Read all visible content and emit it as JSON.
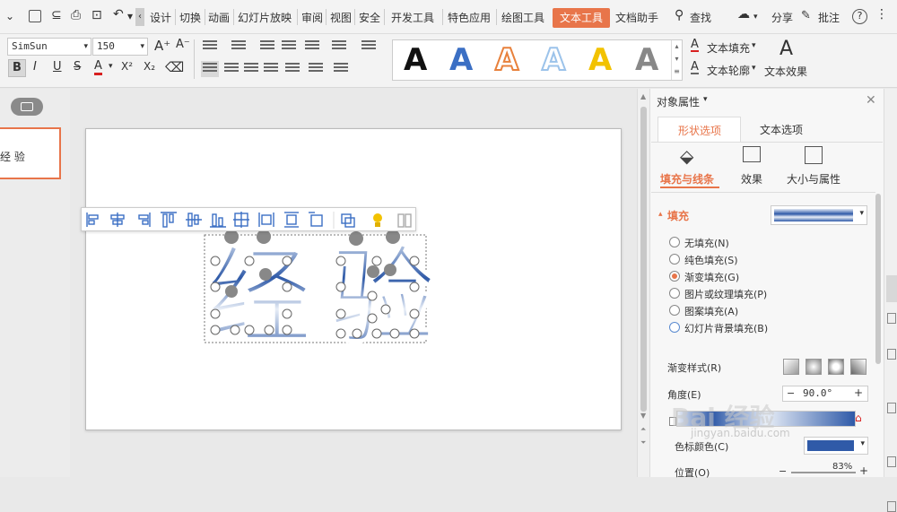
{
  "menu": {
    "tabs": [
      "设计",
      "切换",
      "动画",
      "幻灯片放映",
      "审阅",
      "视图",
      "安全",
      "开发工具",
      "特色应用",
      "绘图工具",
      "文本工具",
      "文档助手"
    ],
    "active_tab": "文本工具",
    "search": "查找",
    "share": "分享",
    "comment": "批注"
  },
  "ribbon": {
    "font_name": "SimSun",
    "font_size": "150",
    "text_fill": "文本填充",
    "text_outline": "文本轮廓",
    "text_effect": "文本效果",
    "text_effect_glyph": "A",
    "style_glyphs": [
      "A",
      "A",
      "A",
      "A",
      "A",
      "A"
    ],
    "style_colors": [
      "#111111",
      "#3b6fc4",
      "#e8813c",
      "#9cc3ea",
      "#f2c200",
      "#888888"
    ],
    "format_buttons": [
      "B",
      "I",
      "U",
      "S",
      "A",
      "X²",
      "X₂"
    ]
  },
  "left_pane": {
    "thumb_text": "经 验"
  },
  "slide": {
    "char1": "经",
    "char2": "验"
  },
  "panel": {
    "title": "对象属性",
    "tab_shape": "形状选项",
    "tab_text": "文本选项",
    "sub_fill_line": "填充与线条",
    "sub_effect": "效果",
    "sub_size": "大小与属性",
    "section_fill": "填充",
    "options": [
      {
        "label": "无填充(N)",
        "selected": false
      },
      {
        "label": "纯色填充(S)",
        "selected": false
      },
      {
        "label": "渐变填充(G)",
        "selected": true
      },
      {
        "label": "图片或纹理填充(P)",
        "selected": false
      },
      {
        "label": "图案填充(A)",
        "selected": false
      },
      {
        "label": "幻灯片背景填充(B)",
        "selected": false
      }
    ],
    "gradient_style": "渐变样式(R)",
    "angle_label": "角度(E)",
    "angle_value": "90.0°",
    "color_label": "色标颜色(C)",
    "position_label": "位置(O)",
    "position_value": "83%"
  },
  "colors": {
    "accent": "#e8754a",
    "gradient_dark": "#2f5aa8",
    "gradient_light": "#dde6f3"
  },
  "watermark": {
    "main": "Bai 经验",
    "sub": "jingyan.baidu.com"
  }
}
